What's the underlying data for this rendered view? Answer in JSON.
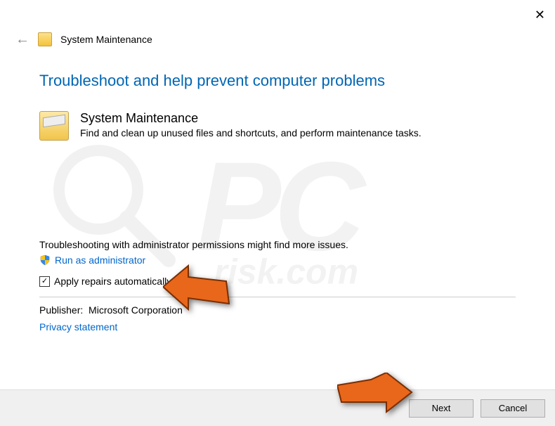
{
  "window": {
    "title": "System Maintenance"
  },
  "heading": "Troubleshoot and help prevent computer problems",
  "item": {
    "title": "System Maintenance",
    "description": "Find and clean up unused files and shortcuts, and perform maintenance tasks."
  },
  "admin": {
    "hint": "Troubleshooting with administrator permissions might find more issues.",
    "link": "Run as administrator"
  },
  "checkbox": {
    "label": "Apply repairs automatically",
    "checked": true
  },
  "publisher": {
    "label": "Publisher:",
    "value": "Microsoft Corporation"
  },
  "privacy_link": "Privacy statement",
  "buttons": {
    "next": "Next",
    "cancel": "Cancel"
  },
  "watermark": {
    "big": "PC",
    "sub": "risk.com"
  }
}
